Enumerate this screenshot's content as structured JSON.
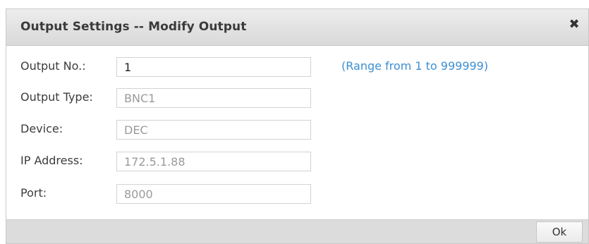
{
  "dialog": {
    "title": "Output Settings -- Modify Output",
    "close_icon": "close-icon",
    "close_glyph": "✖"
  },
  "form": {
    "output_no": {
      "label": "Output No.:",
      "value": "1",
      "hint": "(Range from 1 to 999999)",
      "editable": true
    },
    "output_type": {
      "label": "Output Type:",
      "value": "BNC1",
      "editable": false
    },
    "device": {
      "label": "Device:",
      "value": "DEC",
      "editable": false
    },
    "ip_address": {
      "label": "IP Address:",
      "value": "172.5.1.88",
      "editable": false
    },
    "port": {
      "label": "Port:",
      "value": "8000",
      "editable": false
    }
  },
  "footer": {
    "ok_label": "Ok"
  },
  "colors": {
    "hint_text": "#3d8fd1",
    "titlebar_bg": "#e3e3e3",
    "footer_bg": "#dcdcdc",
    "readonly_text": "#9a9a9a"
  }
}
